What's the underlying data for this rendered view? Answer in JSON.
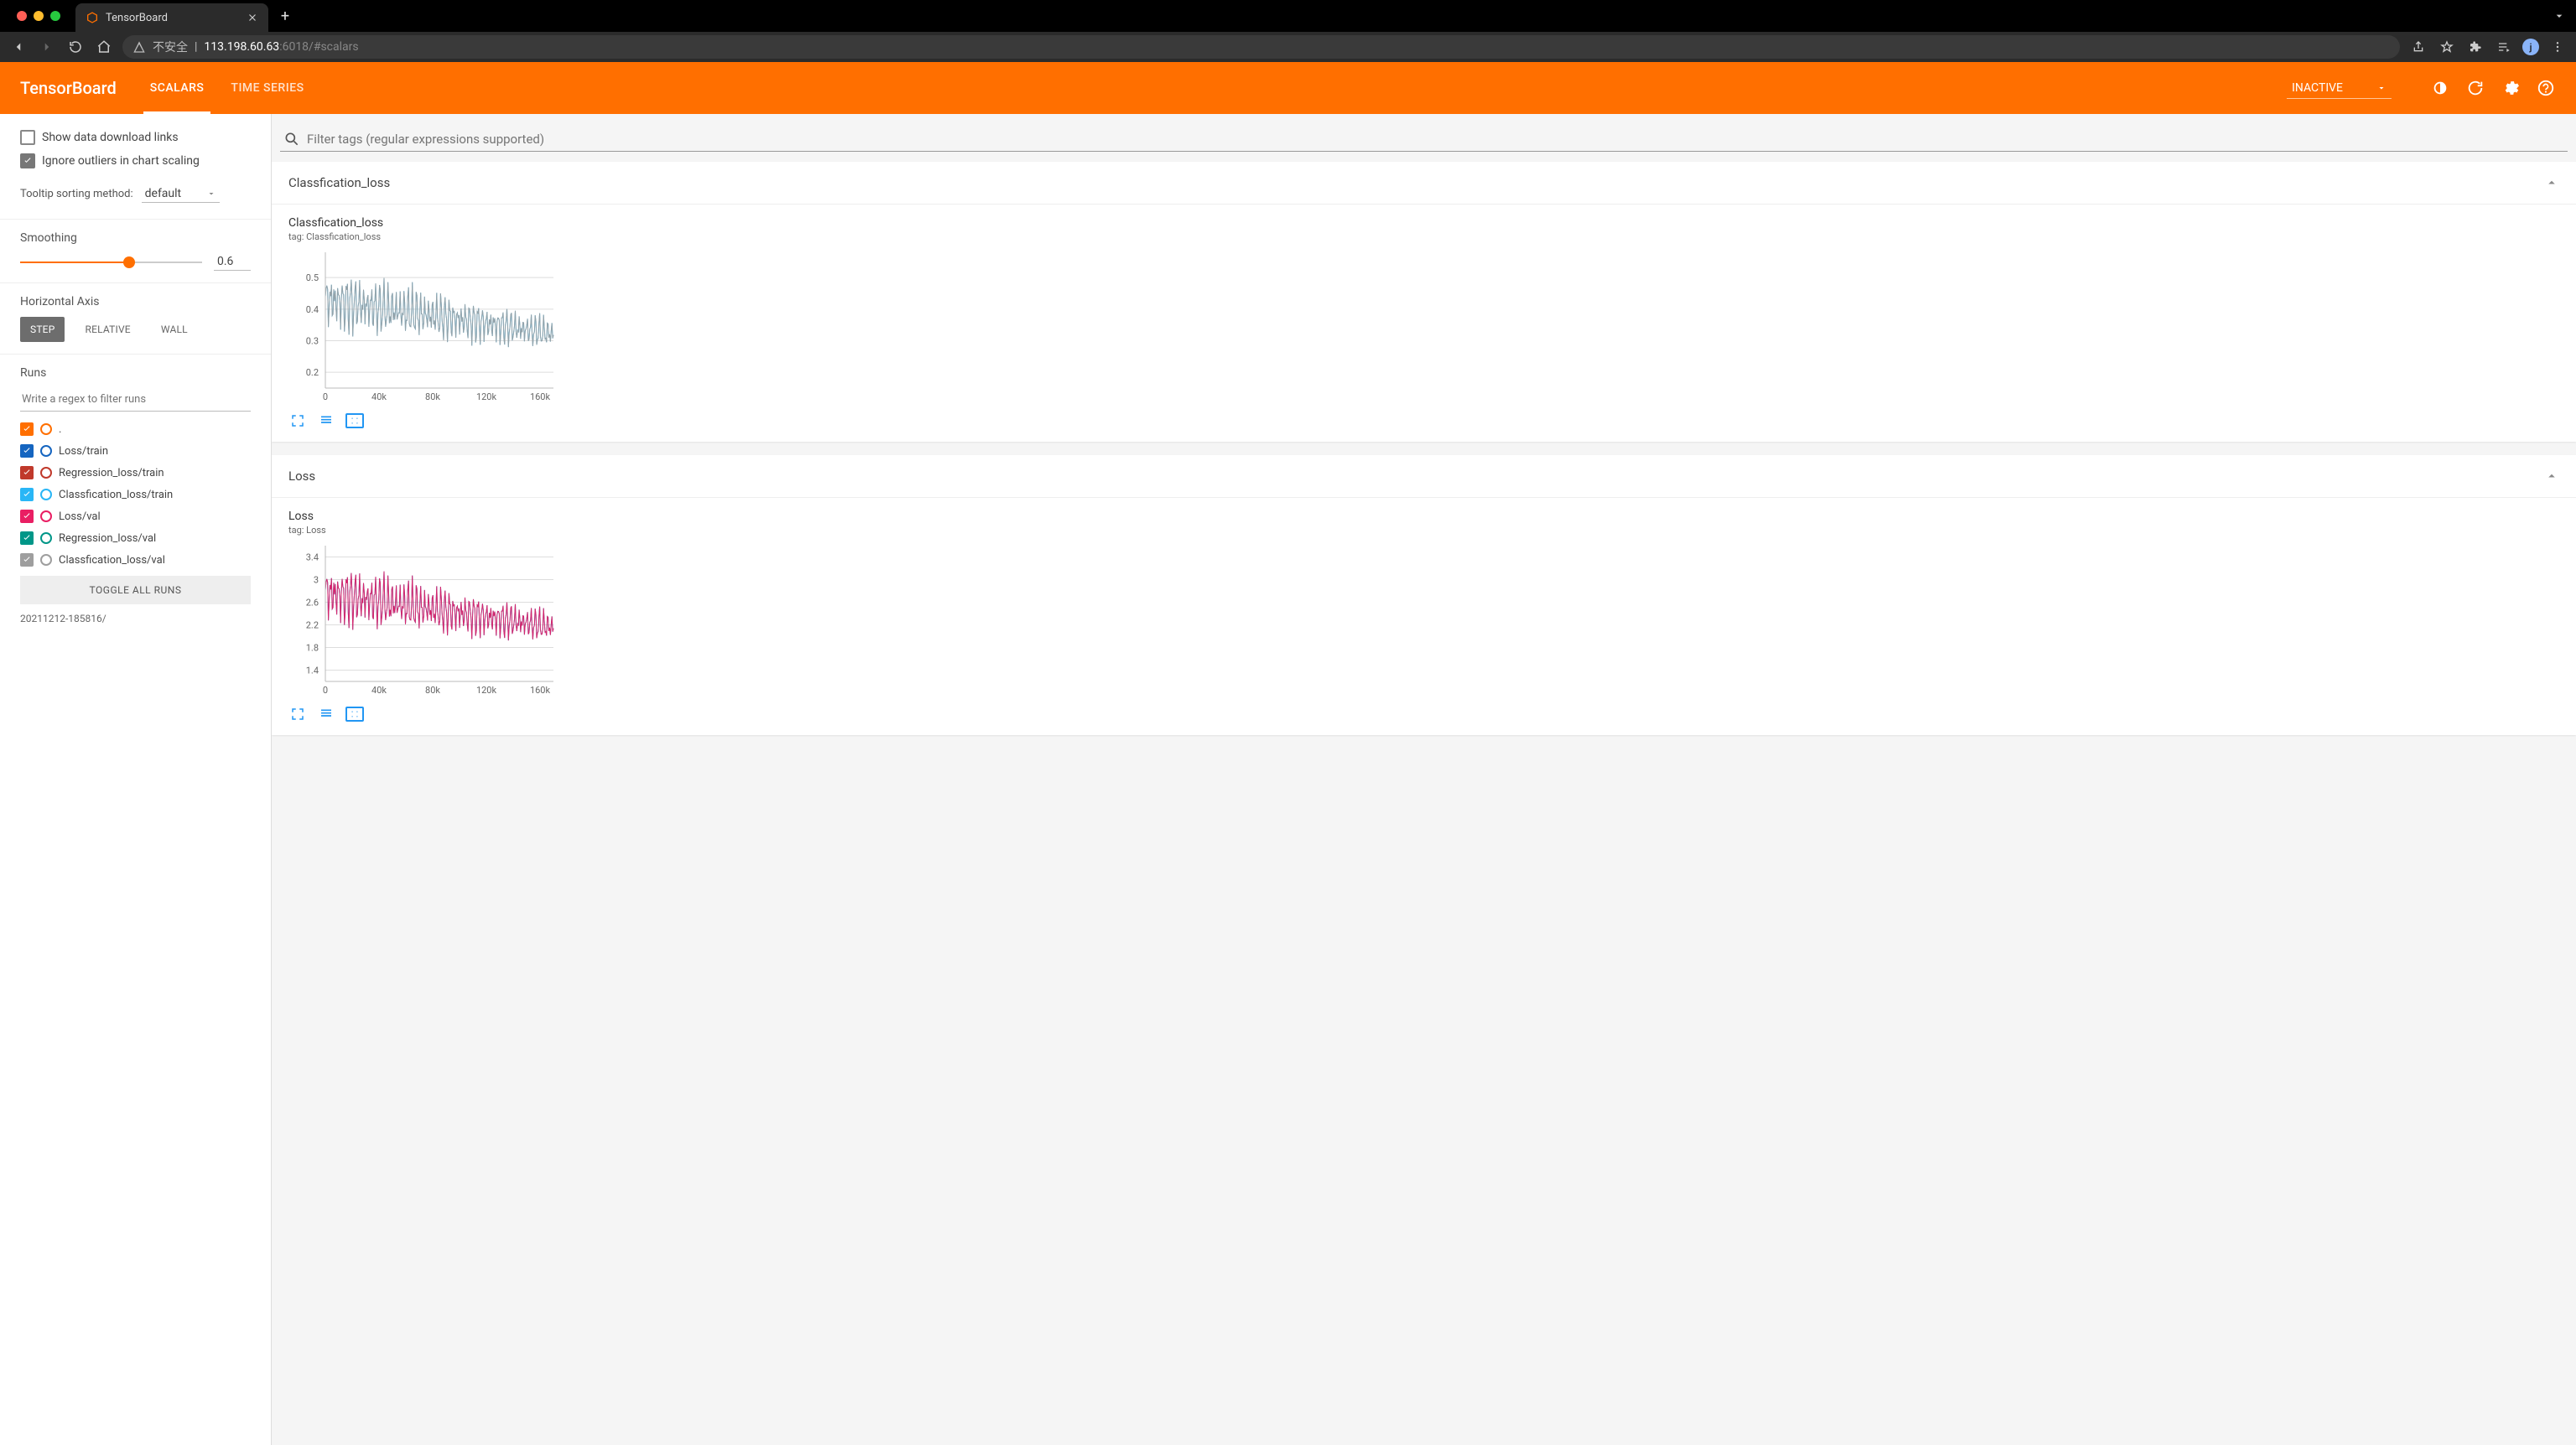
{
  "browser": {
    "tab_title": "TensorBoard",
    "warn_text": "不安全",
    "url_host": "113.198.60.63",
    "url_port_path": ":6018/#scalars",
    "avatar": "j"
  },
  "header": {
    "logo": "TensorBoard",
    "tabs": {
      "scalars": "SCALARS",
      "timeseries": "TIME SERIES"
    },
    "mode_select": "INACTIVE"
  },
  "sidebar": {
    "show_download": "Show data download links",
    "ignore_outliers": "Ignore outliers in chart scaling",
    "tooltip_label": "Tooltip sorting method:",
    "tooltip_value": "default",
    "smoothing_label": "Smoothing",
    "smoothing_value": "0.6",
    "smoothing_fraction": 0.6,
    "horiz_label": "Horizontal Axis",
    "horiz_options": {
      "step": "STEP",
      "relative": "RELATIVE",
      "wall": "WALL"
    },
    "runs_label": "Runs",
    "runs_filter_placeholder": "Write a regex to filter runs",
    "runs": [
      {
        "label": ".",
        "color": "#ff6f00",
        "checked": true
      },
      {
        "label": "Loss/train",
        "color": "#1565c0",
        "checked": true
      },
      {
        "label": "Regression_loss/train",
        "color": "#c0392b",
        "checked": true
      },
      {
        "label": "Classfication_loss/train",
        "color": "#29b6f6",
        "checked": true
      },
      {
        "label": "Loss/val",
        "color": "#e91e63",
        "checked": true
      },
      {
        "label": "Regression_loss/val",
        "color": "#009688",
        "checked": true
      },
      {
        "label": "Classfication_loss/val",
        "color": "#9e9e9e",
        "checked": true
      }
    ],
    "toggle_all": "TOGGLE ALL RUNS",
    "run_folder": "20211212-185816/"
  },
  "search": {
    "placeholder": "Filter tags (regular expressions supported)"
  },
  "cards": [
    {
      "group": "Classfication_loss",
      "title": "Classfication_loss",
      "tag": "tag: Classfication_loss",
      "chart_ref": 0
    },
    {
      "group": "Loss",
      "title": "Loss",
      "tag": "tag: Loss",
      "chart_ref": 1
    }
  ],
  "chart_data": [
    {
      "type": "line",
      "title": "Classfication_loss",
      "xlabel": "",
      "ylabel": "",
      "xlim": [
        0,
        170000
      ],
      "ylim": [
        0.15,
        0.58
      ],
      "xticks": [
        0,
        40000,
        80000,
        120000,
        160000
      ],
      "xtick_labels": [
        "0",
        "40k",
        "80k",
        "120k",
        "160k"
      ],
      "yticks": [
        0.2,
        0.3,
        0.4,
        0.5
      ],
      "series": [
        {
          "name": "Classfication_loss/train",
          "color": "#29b6f6",
          "values_approx": "noisy decaying series from ~0.55 to ~0.30 over 0..170k steps"
        },
        {
          "name": "Classfication_loss/val",
          "color": "#9e9e9e",
          "values_approx": "sparse, near train curve"
        }
      ]
    },
    {
      "type": "line",
      "title": "Loss",
      "xlabel": "",
      "ylabel": "",
      "xlim": [
        0,
        170000
      ],
      "ylim": [
        1.2,
        3.6
      ],
      "xticks": [
        0,
        40000,
        80000,
        120000,
        160000
      ],
      "xtick_labels": [
        "0",
        "40k",
        "80k",
        "120k",
        "160k"
      ],
      "yticks": [
        1.4,
        1.8,
        2.2,
        2.6,
        3.0,
        3.4
      ],
      "series": [
        {
          "name": "Loss/train",
          "color": "#1565c0",
          "values_approx": "noisy decaying series from ~3.5 to ~2.0 over 0..170k steps"
        },
        {
          "name": "Loss/val",
          "color": "#e91e63",
          "values_approx": "sparse points near ~2.2 in late steps"
        }
      ]
    }
  ]
}
